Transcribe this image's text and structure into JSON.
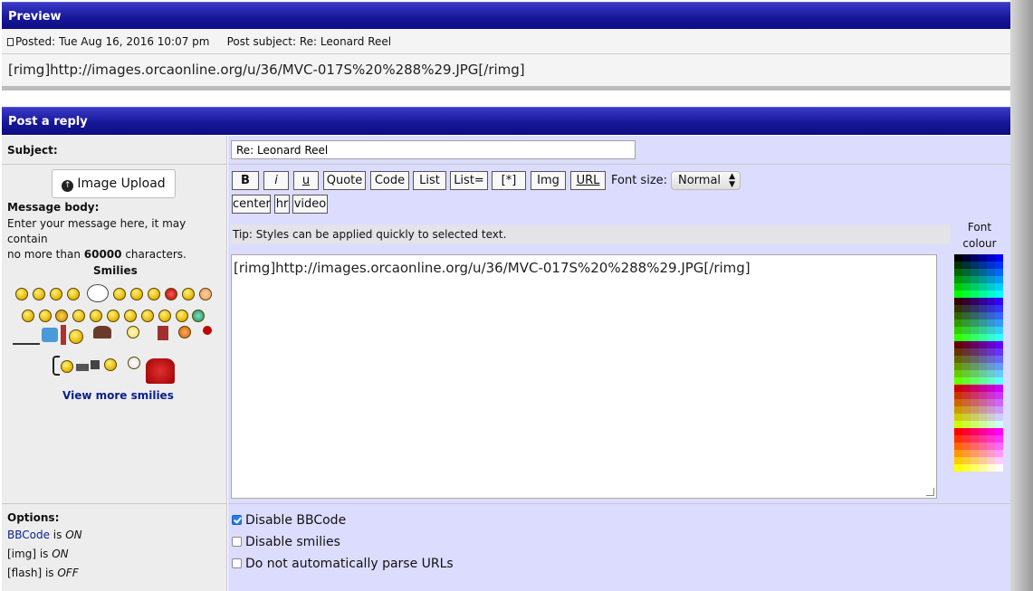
{
  "preview": {
    "header": "Preview",
    "posted": "Posted: Tue Aug 16, 2016 10:07 pm",
    "subject": "Post subject: Re: Leonard Reel",
    "body": "[rimg]http://images.orcaonline.org/u/36/MVC-017S%20%288%29.JPG[/rimg]"
  },
  "reply": {
    "header": "Post a reply",
    "subject_label": "Subject:",
    "subject_value": "Re: Leonard Reel",
    "upload_label": "Image Upload",
    "message_title": "Message body:",
    "message_desc_1": "Enter your message here, it may contain",
    "message_desc_2": "no more than ",
    "message_limit": "60000",
    "message_desc_3": " characters.",
    "smilies_title": "Smilies",
    "view_more": "View more smilies"
  },
  "toolbar": {
    "bold": "B",
    "italic": "i",
    "underline": "u",
    "quote": "Quote",
    "code": "Code",
    "list": "List",
    "list_eq": "List=",
    "item": "[*]",
    "img": "Img",
    "url": "URL",
    "font_size_label": "Font size:",
    "font_size_value": "Normal",
    "center": "center",
    "hr": "hr",
    "video": "video"
  },
  "tip": "Tip: Styles can be applied quickly to selected text.",
  "font_colour_label": "Font colour",
  "message_text": "[rimg]http://images.orcaonline.org/u/36/MVC-017S%20%288%29.JPG[/rimg]",
  "options": {
    "title": "Options:",
    "bbcode_link": "BBCode",
    "bbcode_state": "ON",
    "img_label": "[img]",
    "img_state": "ON",
    "flash_label": "[flash]",
    "flash_state": "OFF",
    "is_word": " is ",
    "disable_bbcode": "Disable BBCode",
    "disable_smilies": "Disable smilies",
    "no_parse_urls": "Do not automatically parse URLs",
    "disable_bbcode_checked": true
  },
  "colors": {
    "header_blue": "#17179a",
    "reply_panel": "#dcdcff",
    "link_blue": "#0a1f8a"
  }
}
